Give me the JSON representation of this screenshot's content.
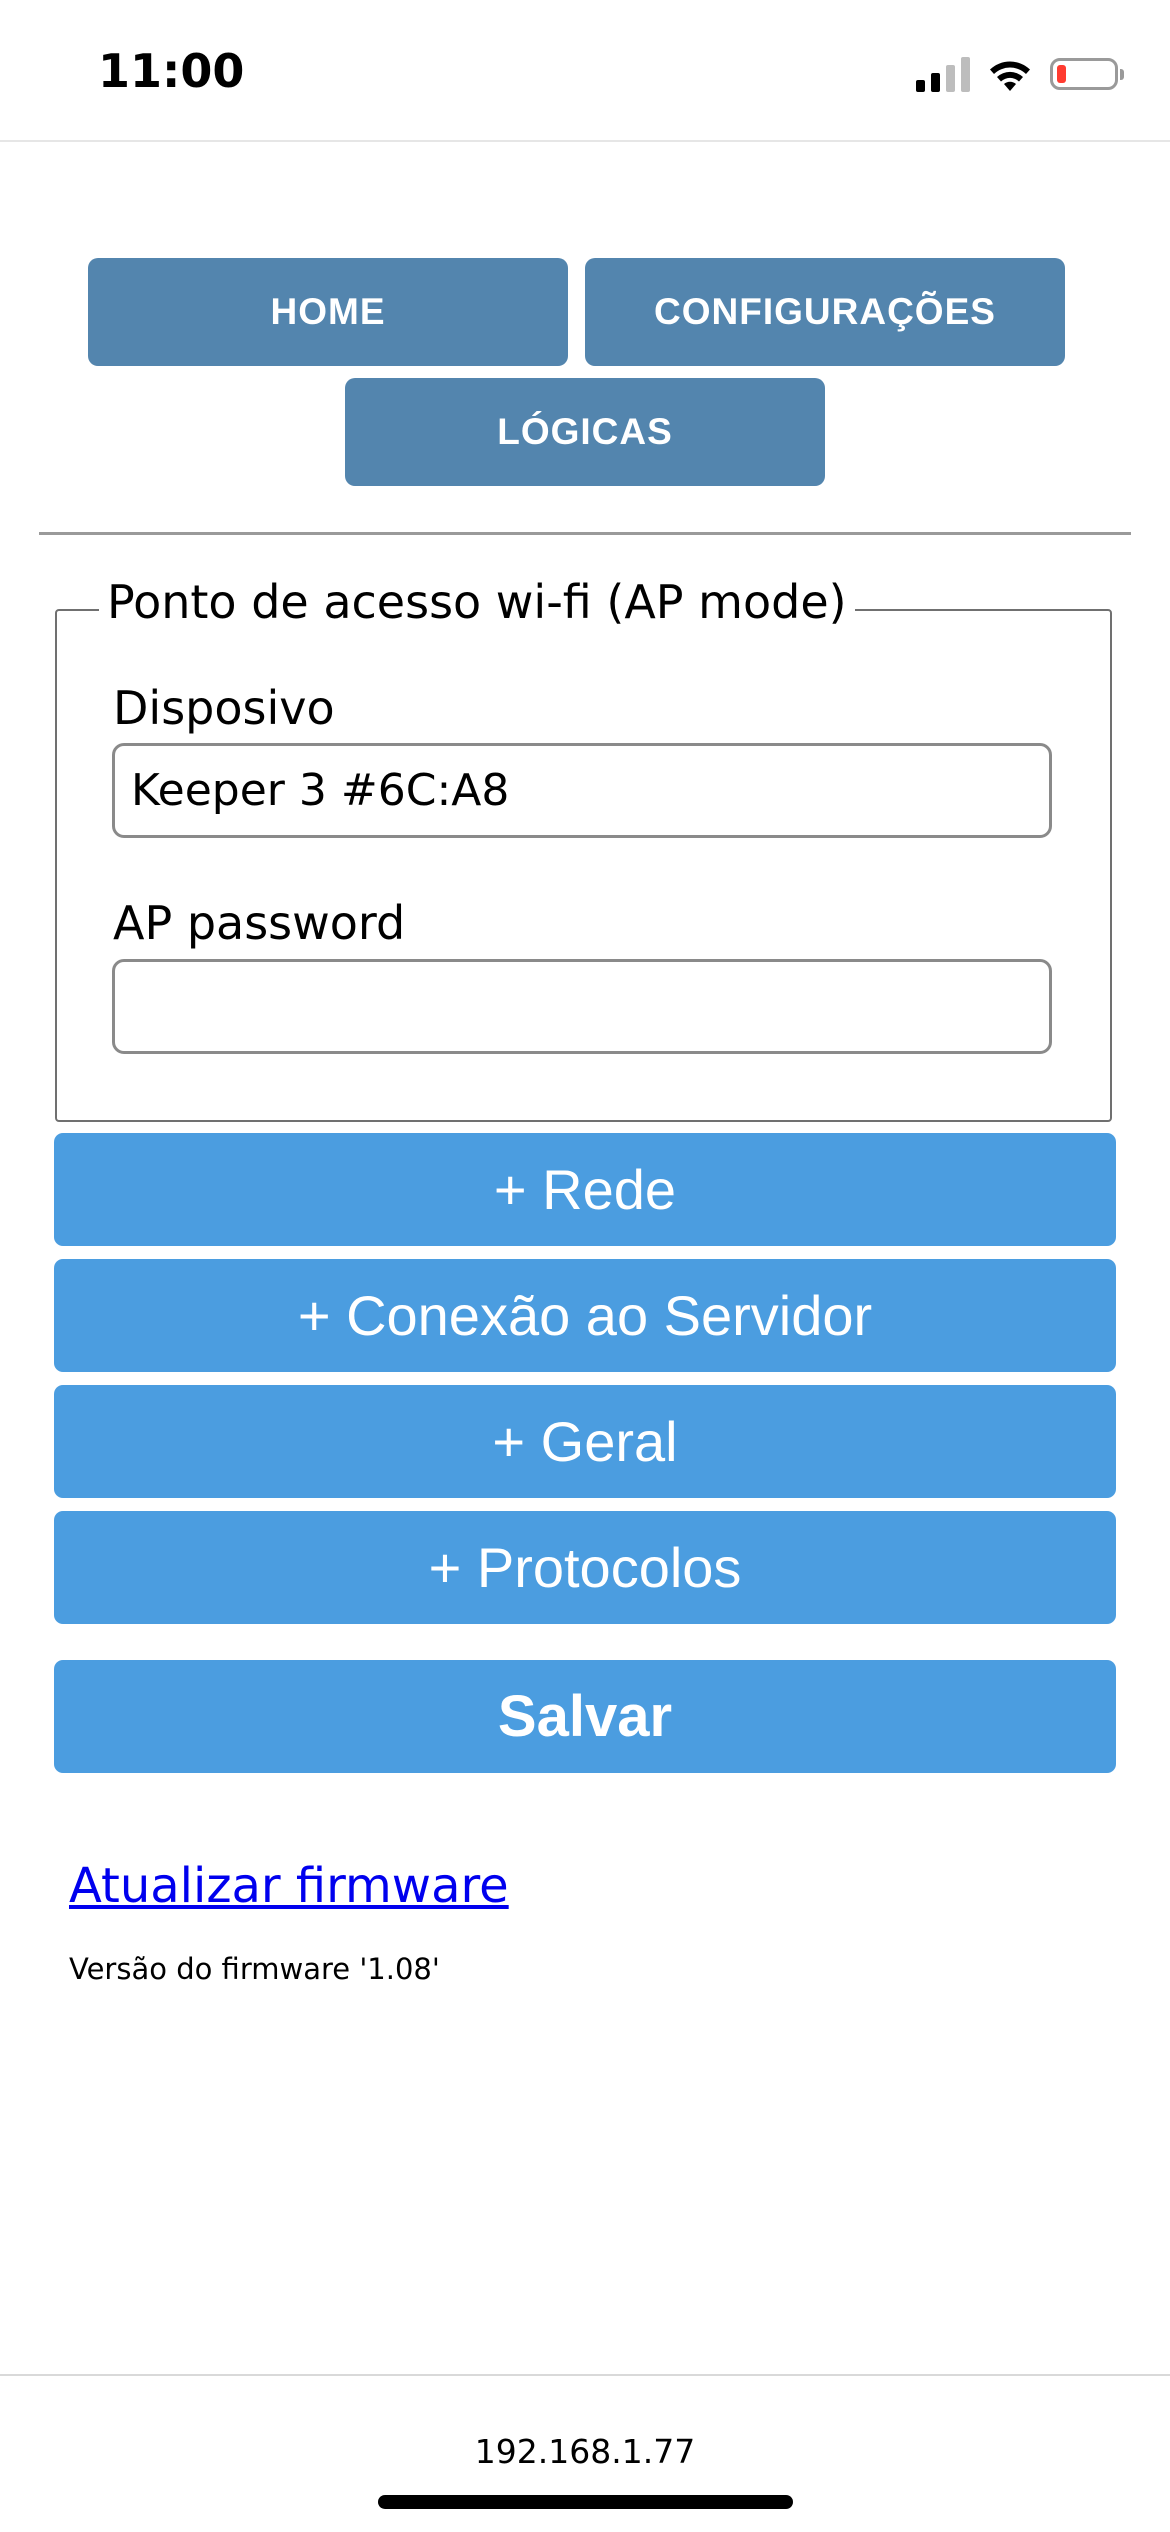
{
  "status_bar": {
    "time": "11:00",
    "icons": [
      "cellular-signal-icon",
      "wifi-icon",
      "battery-icon"
    ],
    "battery_color": "#ff3b30"
  },
  "nav": {
    "home_label": "HOME",
    "config_label": "CONFIGURAÇÕES",
    "logic_label": "LÓGICAS",
    "button_color": "#5385ae"
  },
  "ap_section": {
    "legend": "Ponto de acesso wi-fi (AP mode)",
    "device_label": "Disposivo",
    "device_value": "Keeper 3 #6C:A8",
    "password_label": "AP password",
    "password_value": ""
  },
  "sections": {
    "rede": "+ Rede",
    "servidor": "+ Conexão ao Servidor",
    "geral": "+ Geral",
    "protocolos": "+ Protocolos",
    "button_color": "#4b9de0"
  },
  "save_label": "Salvar",
  "firmware": {
    "update_link": "Atualizar firmware",
    "version_text": "Versão do firmware '1.08'",
    "link_color": "#0000ee"
  },
  "browser": {
    "address": "192.168.1.77"
  }
}
